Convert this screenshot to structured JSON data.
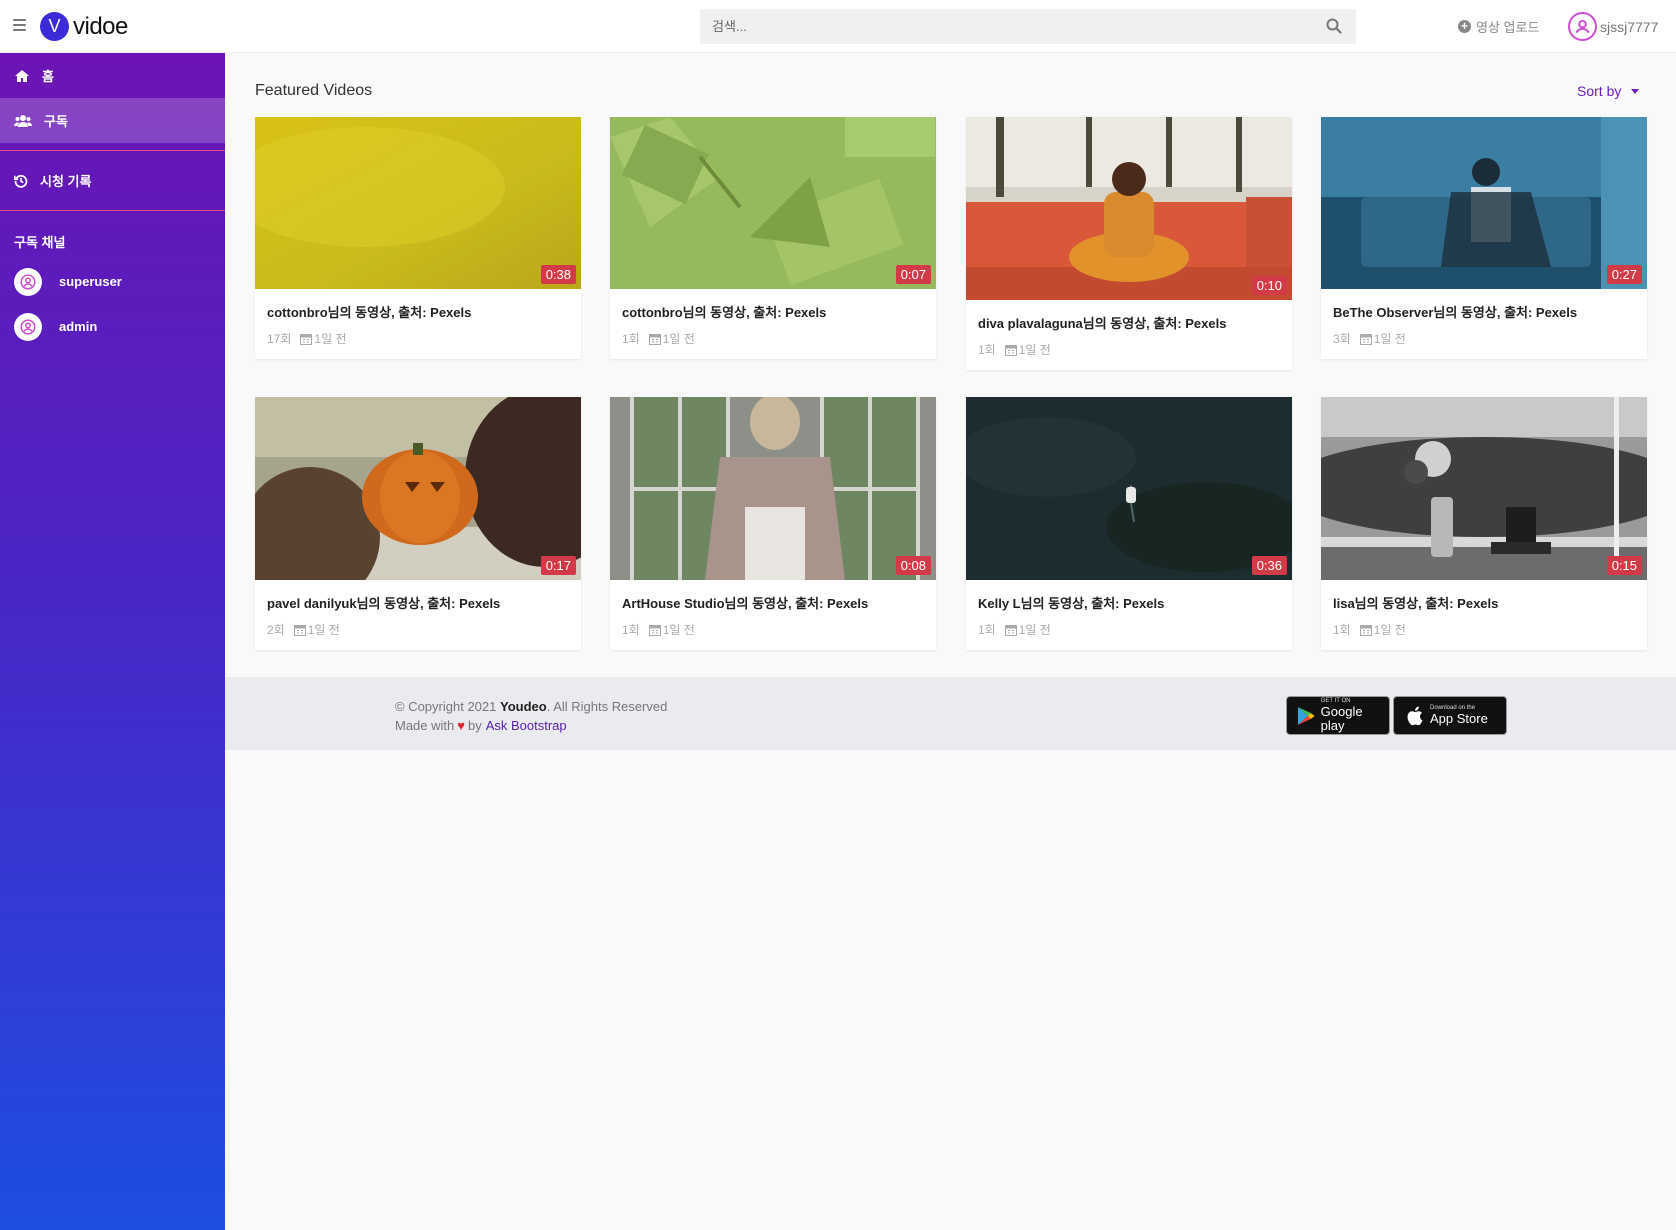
{
  "app": {
    "logo_letter": "V",
    "logo_text": "vidoe"
  },
  "header": {
    "search_placeholder": "검색...",
    "upload_label": "영상 업로드",
    "username": "sjssj7777"
  },
  "sidebar": {
    "items": [
      {
        "label": "홈",
        "icon": "home-icon"
      },
      {
        "label": "구독",
        "icon": "users-icon"
      },
      {
        "label": "시청 기록",
        "icon": "history-icon"
      }
    ],
    "channels_heading": "구독 채널",
    "channels": [
      {
        "name": "superuser"
      },
      {
        "name": "admin"
      }
    ]
  },
  "main": {
    "section_title": "Featured Videos",
    "sort_label": "Sort by",
    "videos": [
      {
        "title": "cottonbro님의 동영상, 출처: Pexels",
        "views": "17회",
        "date": "1일 전",
        "duration": "0:38"
      },
      {
        "title": "cottonbro님의 동영상, 출처: Pexels",
        "views": "1회",
        "date": "1일 전",
        "duration": "0:07"
      },
      {
        "title": "diva plavalaguna님의 동영상, 출처: Pexels",
        "views": "1회",
        "date": "1일 전",
        "duration": "0:10"
      },
      {
        "title": "BeThe Observer님의 동영상, 출처: Pexels",
        "views": "3회",
        "date": "1일 전",
        "duration": "0:27"
      },
      {
        "title": "pavel danilyuk님의 동영상, 출처: Pexels",
        "views": "2회",
        "date": "1일 전",
        "duration": "0:17"
      },
      {
        "title": "ArtHouse Studio님의 동영상, 출처: Pexels",
        "views": "1회",
        "date": "1일 전",
        "duration": "0:08"
      },
      {
        "title": "Kelly L님의 동영상, 출처: Pexels",
        "views": "1회",
        "date": "1일 전",
        "duration": "0:36"
      },
      {
        "title": "lisa님의 동영상, 출처: Pexels",
        "views": "1회",
        "date": "1일 전",
        "duration": "0:15"
      }
    ]
  },
  "footer": {
    "copyright_prefix": "© Copyright 2021",
    "brand": "Youdeo",
    "rights": ". All Rights Reserved",
    "made_with": "Made with",
    "by": "by",
    "link": "Ask Bootstrap",
    "google_play": {
      "small": "GET IT ON",
      "big": "Google play"
    },
    "app_store": {
      "small": "Download on the",
      "big": "App Store"
    }
  },
  "colors": {
    "accent": "#6b1fb8",
    "duration_badge": "#d23a48",
    "sidebar_top": "#6c14b3",
    "sidebar_bottom": "#1d4ee0"
  }
}
